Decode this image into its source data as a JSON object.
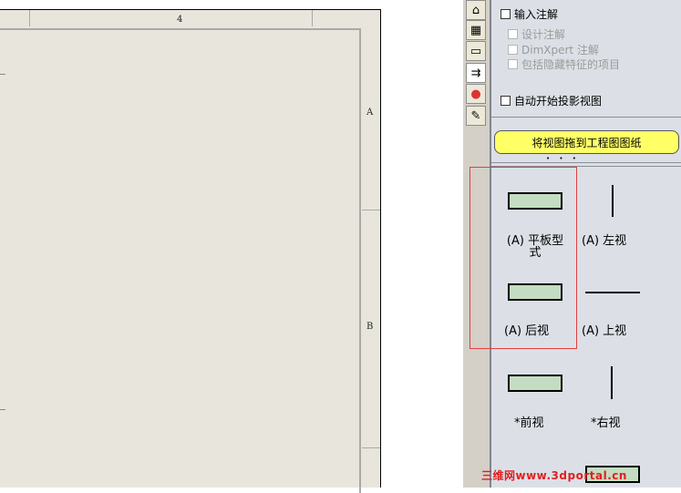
{
  "drawing": {
    "column_label": "4",
    "row_labels": [
      "A",
      "B"
    ]
  },
  "tabs": [
    {
      "icon": "home-icon",
      "glyph": "⌂"
    },
    {
      "icon": "library-icon",
      "glyph": "▦"
    },
    {
      "icon": "folder-icon",
      "glyph": "▭"
    },
    {
      "icon": "view-palette-icon",
      "glyph": "⇉"
    },
    {
      "icon": "appearance-icon",
      "glyph": "●"
    },
    {
      "icon": "custom-properties-icon",
      "glyph": "✎"
    }
  ],
  "options": {
    "import_annotations": "输入注解",
    "design_annotations": "设计注解",
    "dimxpert_annotations": "DimXpert 注解",
    "include_hidden": "包括隐藏特征的项目",
    "auto_projected": "自动开始投影视图"
  },
  "drag_button": "将视图拖到工程图图纸",
  "views": {
    "flat_pattern": "(A) 平板型\n式",
    "left": "(A) 左视",
    "back": "(A) 后视",
    "top": "(A) 上视",
    "front": "*前视",
    "right": "*右视"
  },
  "colors": {
    "sheet": "#e8e6dc",
    "panel": "#dce0e6",
    "drag_button": "#ffff66",
    "thumbnail_fill": "#c4ddc2",
    "highlight_box": "#e04040"
  },
  "watermark": "三维网www.3dportal.cn"
}
